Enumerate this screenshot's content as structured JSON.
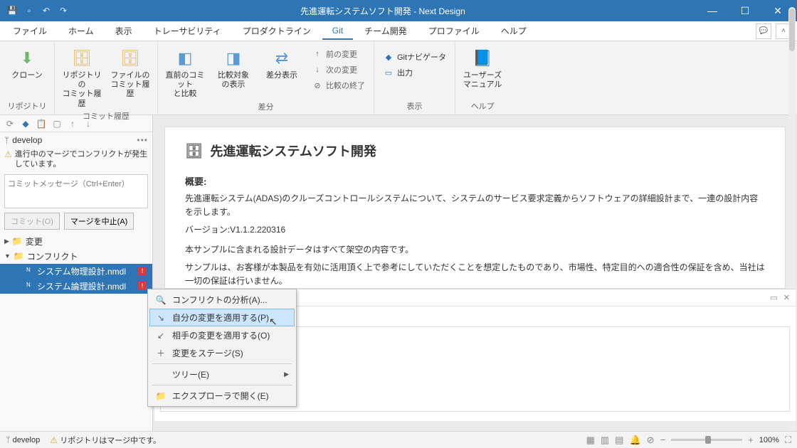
{
  "app": {
    "title": "先進運転システムソフト開発 - Next Design"
  },
  "menu": {
    "items": [
      "ファイル",
      "ホーム",
      "表示",
      "トレーサビリティ",
      "プロダクトライン",
      "Git",
      "チーム開発",
      "プロファイル",
      "ヘルプ"
    ],
    "active_index": 5
  },
  "ribbon": {
    "groups": [
      {
        "label": "リポジトリ",
        "buttons": [
          {
            "label": "クローン"
          }
        ]
      },
      {
        "label": "コミット履歴",
        "buttons": [
          {
            "label": "リポジトリの\nコミット履歴"
          },
          {
            "label": "ファイルの\nコミット履歴"
          }
        ]
      },
      {
        "label": "差分",
        "buttons": [
          {
            "label": "直前のコミット\nと比較"
          },
          {
            "label": "比較対象\nの表示"
          },
          {
            "label": "差分表示"
          }
        ],
        "small": [
          {
            "label": "前の変更"
          },
          {
            "label": "次の変更"
          },
          {
            "label": "比較の終了"
          }
        ]
      },
      {
        "label": "表示",
        "small": [
          {
            "label": "Gitナビゲータ"
          },
          {
            "label": "出力"
          }
        ]
      },
      {
        "label": "ヘルプ",
        "buttons": [
          {
            "label": "ユーザーズ\nマニュアル"
          }
        ]
      }
    ]
  },
  "sidebar": {
    "branch": "develop",
    "warning": "進行中のマージでコンフリクトが発生しています。",
    "commit_placeholder": "コミットメッセージ（Ctrl+Enter）",
    "commit_btn": "コミット(O)",
    "abort_btn": "マージを中止(A)",
    "tree": {
      "changes": "変更",
      "conflicts": "コンフリクト",
      "files": [
        "システム物理設計.nmdl",
        "システム論理設計.nmdl"
      ]
    }
  },
  "doc": {
    "title": "先進運転システムソフト開発",
    "overview_label": "概要:",
    "p1": "先進運転システム(ADAS)のクルーズコントロールシステムについて、システムのサービス要求定義からソフトウェアの詳細設計まで、一連の設計内容を示します。",
    "p2": "バージョン:V1.1.2.220316",
    "p3": "本サンプルに含まれる設計データはすべて架空の内容です。",
    "p4": "サンプルは、お客様が本製品を有効に活用頂く上で参考にしていただくことを想定したものであり、市場性、特定目的への適合性の保証を含め、当社は一切の保証は行いません。"
  },
  "ctx": {
    "items": [
      "コンフリクトの分析(A)...",
      "自分の変更を適用する(P)",
      "相手の変更を適用する(O)",
      "変更をステージ(S)",
      "ツリー(E)",
      "エクスプローラで開く(E)"
    ]
  },
  "status": {
    "branch": "develop",
    "msg": "リポジトリはマージ中です。",
    "zoom": "100%"
  }
}
